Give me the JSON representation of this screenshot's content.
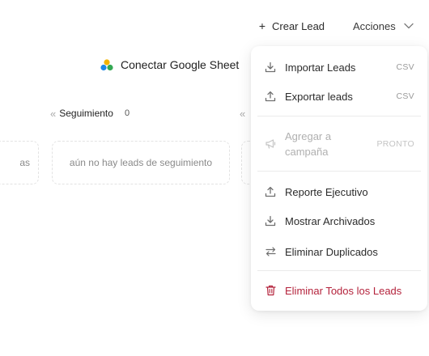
{
  "toolbar": {
    "create_lead_icon": "+",
    "create_lead_label": "Crear Lead",
    "actions_label": "Acciones"
  },
  "google_sheet": {
    "label": "Conectar Google Sheet",
    "icon": "google-sheets-logo"
  },
  "board": {
    "column_label": "Seguimiento",
    "column_count": "0",
    "collapse_glyph": "«",
    "left_card_text": "as",
    "empty_text": "aún no hay leads de seguimiento"
  },
  "menu": {
    "items": [
      {
        "label": "Importar Leads",
        "tag": "CSV",
        "icon": "download-icon"
      },
      {
        "label": "Exportar leads",
        "tag": "CSV",
        "icon": "upload-icon"
      },
      {
        "label_line1": "Agregar a",
        "label_line2": "campaña",
        "tag": "PRONTO",
        "icon": "megaphone-icon",
        "disabled": true
      },
      {
        "label": "Reporte Ejecutivo",
        "icon": "upload-icon"
      },
      {
        "label": "Mostrar Archivados",
        "icon": "download-icon"
      },
      {
        "label": "Eliminar Duplicados",
        "icon": "swap-arrows-icon"
      },
      {
        "label": "Eliminar Todos los Leads",
        "icon": "trash-icon",
        "danger": true
      }
    ]
  },
  "colors": {
    "danger": "#b4233c",
    "text": "#2b2b2b",
    "muted": "#9a9a9a"
  }
}
